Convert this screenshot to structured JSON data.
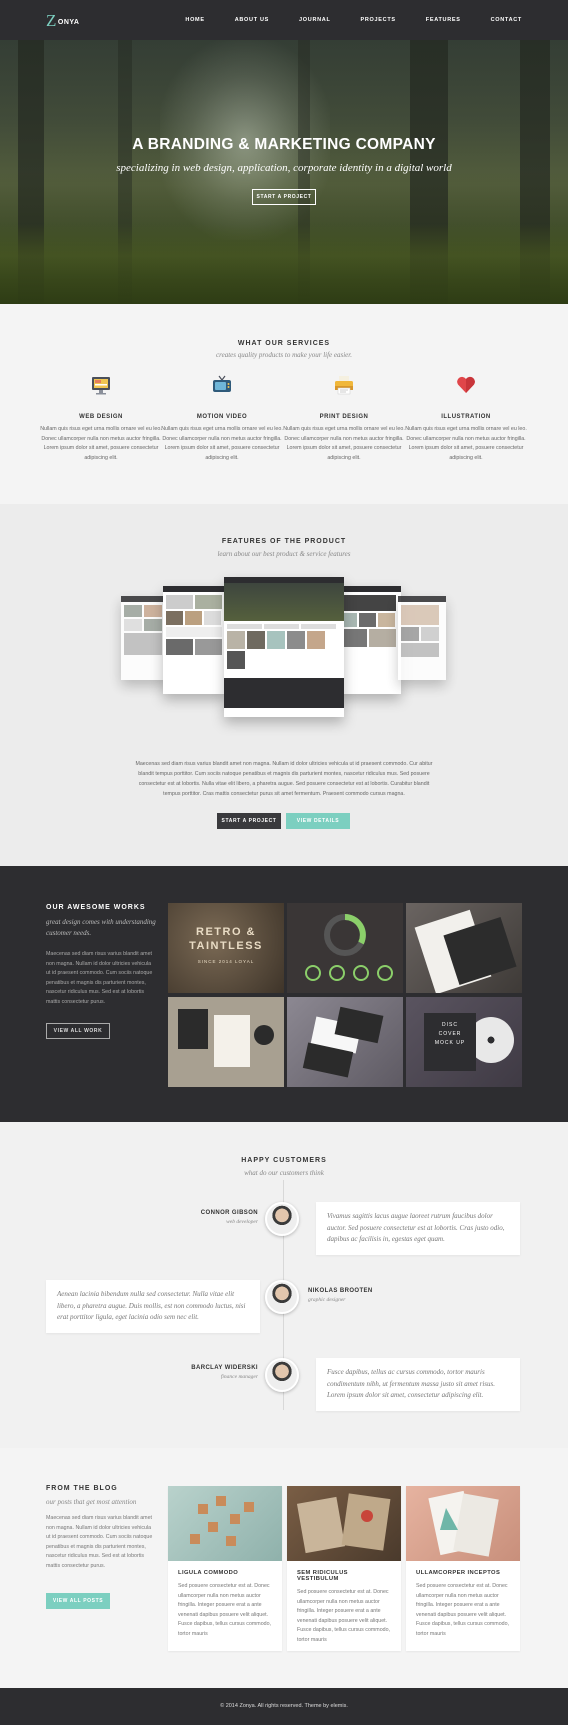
{
  "brand": {
    "letter": "Z",
    "name": "ONYA"
  },
  "nav": {
    "items": [
      "HOME",
      "ABOUT US",
      "JOURNAL",
      "PROJECTS",
      "FEATURES",
      "CONTACT"
    ]
  },
  "hero": {
    "title": "A BRANDING & MARKETING COMPANY",
    "subtitle": "specializing in web design, application, corporate identity in a digital world",
    "cta": "START A PROJECT"
  },
  "services": {
    "title": "WHAT OUR SERVICES",
    "subtitle": "creates quality products to make your life easier.",
    "items": [
      {
        "icon": "monitor-icon",
        "title": "WEB DESIGN",
        "text": "Nullam quis risus eget urna mollis ornare vel eu leo. Donec ullamcorper nulla non metus auctor fringilla. Lorem ipsum dolor sit amet, posuere consectetur adipiscing elit."
      },
      {
        "icon": "tv-icon",
        "title": "MOTION VIDEO",
        "text": "Nullam quis risus eget urna mollis ornare vel eu leo. Donec ullamcorper nulla non metus auctor fringilla. Lorem ipsum dolor sit amet, posuere consectetur adipiscing elit."
      },
      {
        "icon": "printer-icon",
        "title": "PRINT DESIGN",
        "text": "Nullam quis risus eget urna mollis ornare vel eu leo. Donec ullamcorper nulla non metus auctor fringilla. Lorem ipsum dolor sit amet, posuere consectetur adipiscing elit."
      },
      {
        "icon": "heart-icon",
        "title": "ILLUSTRATION",
        "text": "Nullam quis risus eget urna mollis ornare vel eu leo. Donec ullamcorper nulla non metus auctor fringilla. Lorem ipsum dolor sit amet, posuere consectetur adipiscing elit."
      }
    ]
  },
  "features": {
    "title": "FEATURES OF THE PRODUCT",
    "subtitle": "learn about our best product & service features",
    "text": "Maecenas sed diam risus varius blandit amet non magna. Nullam id dolor ultricies vehicula ut id praesent commodo. Cur abitur blandit tempus porttitor. Cum sociis natoque penatibus et magnis dis parturient montes, nascetur ridiculus mus. Sed posuere consectetur est at lobortis. Nulla vitae elit libero, a pharetra augue. Sed posuere consectetur est at lobortis. Curabitur blandit tempus porttitor. Cras mattis consectetur purus sit amet fermentum. Praesent commodo cursus magna.",
    "btn_primary": "START A PROJECT",
    "btn_secondary": "VIEW DETAILS"
  },
  "works": {
    "title": "OUR AWESOME WORKS",
    "tagline": "great design comes with understanding customer needs.",
    "text": "Maecenas sed diam risus varius blandit amet non magna. Nullam id dolor ultricies vehicula ut id praesent commodo. Cum sociis natoque penatibus et magnis dis parturient montes, nascetur ridiculus mus. Sed est at lobortis mattis consectetur purus.",
    "button": "VIEW ALL WORK",
    "retro_text": "RETRO & TAINTLESS",
    "retro_sub": "SINCE 2014 LOYAL",
    "disc_text": "DISC COVER MOCK UP"
  },
  "testimonials": {
    "title": "HAPPY CUSTOMERS",
    "subtitle": "what do our customers think",
    "items": [
      {
        "name": "CONNOR GIBSON",
        "role": "web developer",
        "quote": "Vivamus sagittis lacus augue laoreet rutrum faucibus dolor auctor. Sed posuere consectetur est at lobortis. Cras justo odio, dapibus ac facilisis in, egestas eget quam."
      },
      {
        "name": "NIKOLAS BROOTEN",
        "role": "graphic designer",
        "quote": "Aenean lacinia bibendum nulla sed consectetur. Nulla vitae elit libero, a pharetra augue. Duis mollis, est non commodo luctus, nisi erat porttitor ligula, eget lacinia odio sem nec elit."
      },
      {
        "name": "BARCLAY WIDERSKI",
        "role": "finance manager",
        "quote": "Fusce dapibus, tellus ac cursus commodo, tortor mauris condimentum nibh, ut fermentum massa justo sit amet risus. Lorem ipsum dolor sit amet, consectetur adipiscing elit."
      }
    ]
  },
  "blog": {
    "title": "FROM THE BLOG",
    "tagline": "our posts that get most attention",
    "text": "Maecenas sed diam risus varius blandit amet non magna. Nullam id dolor ultricies vehicula ut id praesent commodo. Cum sociis natoque penatibus et magnis dis parturient montes, nascetur ridiculus mus. Sed est at lobortis mattis consectetur purus.",
    "button": "VIEW ALL POSTS",
    "posts": [
      {
        "title": "LIGULA COMMODO",
        "text": "Sed posuere consectetur est at. Donec ullamcorper nulla non metus auctor fringilla. Integer posuere erat a ante venenati dapibus posuere velit aliquet. Fusce dapibus, tellus cursus commodo, tortor mauris"
      },
      {
        "title": "SEM RIDICULUS VESTIBULUM",
        "text": "Sed posuere consectetur est at. Donec ullamcorper nulla non metus auctor fringilla. Integer posuere erat a ante venenati dapibus posuere velit aliquet. Fusce dapibus, tellus cursus commodo, tortor mauris"
      },
      {
        "title": "ULLAMCORPER INCEPTOS",
        "text": "Sed posuere consectetur est at. Donec ullamcorper nulla non metus auctor fringilla. Integer posuere erat a ante venenati dapibus posuere velit aliquet. Fusce dapibus, tellus cursus commodo, tortor mauris"
      }
    ]
  },
  "footer": {
    "text": "© 2014 Zonya. All rights reserved. Theme by elemis."
  },
  "colors": {
    "accent": "#7ccfc0",
    "dark": "#2d2d30",
    "light_bg": "#f4f4f4"
  }
}
